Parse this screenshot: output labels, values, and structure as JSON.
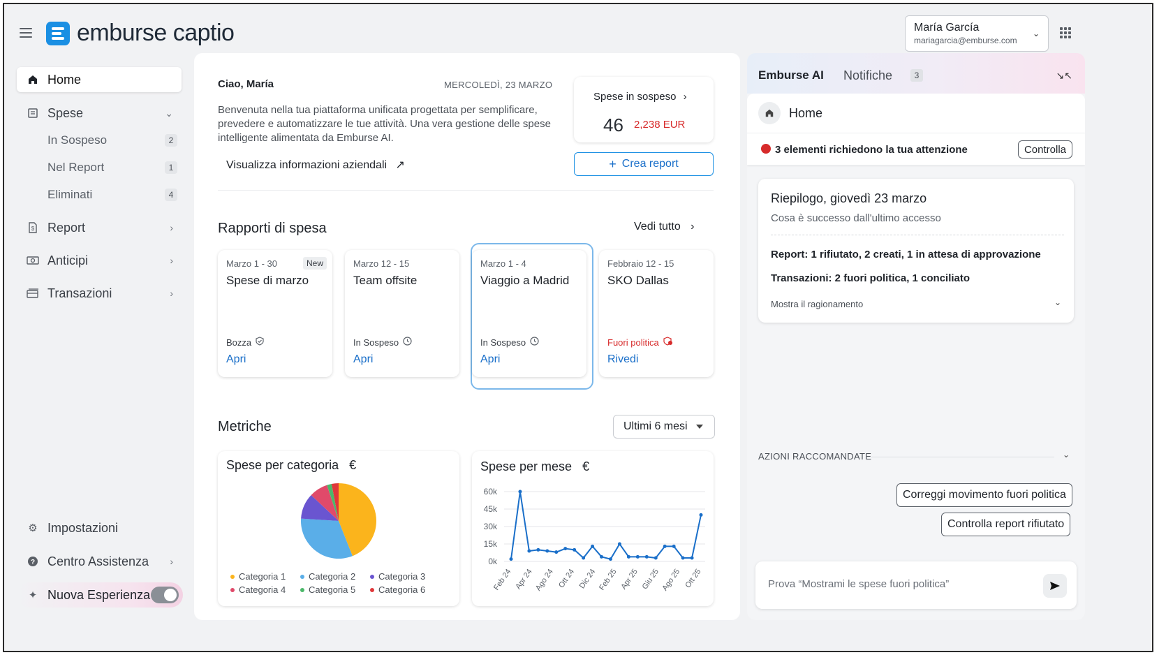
{
  "app": {
    "logo_text": "emburse captio",
    "brand_color": "#1a8fe3"
  },
  "user": {
    "name": "María García",
    "email": "mariagarcia@emburse.com"
  },
  "sidebar": {
    "home": "Home",
    "spese": "Spese",
    "sub": [
      {
        "label": "In Sospeso",
        "count": "2"
      },
      {
        "label": "Nel Report",
        "count": "1"
      },
      {
        "label": "Eliminati",
        "count": "4"
      }
    ],
    "report": "Report",
    "anticipi": "Anticipi",
    "transazioni": "Transazioni",
    "impostazioni": "Impostazioni",
    "assistenza": "Centro Assistenza",
    "nuova": "Nuova Esperienza"
  },
  "main": {
    "greeting": "Ciao, María",
    "date": "MERCOLEDÌ, 23 MARZO",
    "welcome": "Benvenuta nella tua piattaforma unificata progettata per semplificare, prevedere e automatizzare le tue attività. Una vera gestione delle spese intelligente alimentata da Emburse AI.",
    "company_link": "Visualizza informazioni aziendali",
    "pending": {
      "title": "Spese in sospeso",
      "count": "46",
      "amount": "2,238 EUR"
    },
    "create_button": "Crea report",
    "reports_title": "Rapporti di spesa",
    "see_all": "Vedi tutto",
    "reports": [
      {
        "dates": "Marzo 1 - 30",
        "badge": "New",
        "name": "Spese di marzo",
        "status": "Bozza",
        "action": "Apri"
      },
      {
        "dates": "Marzo 12 - 15",
        "name": "Team offsite",
        "status": "In Sospeso",
        "action": "Apri"
      },
      {
        "dates": "Marzo 1 - 4",
        "name": "Viaggio a Madrid",
        "status": "In Sospeso",
        "action": "Apri"
      },
      {
        "dates": "Febbraio 12 - 15",
        "name": "SKO Dallas",
        "status": "Fuori politica",
        "action": "Rivedi"
      }
    ],
    "metrics_title": "Metriche",
    "period": "Ultimi 6 mesi",
    "euro_symbol": "€"
  },
  "chart_data": [
    {
      "type": "pie",
      "title": "Spese per categoria",
      "categories": [
        "Categoria 1",
        "Categoria 2",
        "Categoria 3",
        "Categoria 4",
        "Categoria 5",
        "Categoria 6"
      ],
      "values": [
        44,
        32,
        11,
        8,
        2,
        3
      ],
      "colors": [
        "#fbb41c",
        "#5aaee8",
        "#6a55d0",
        "#e04a6a",
        "#4cb86a",
        "#e0383a"
      ]
    },
    {
      "type": "line",
      "title": "Spese per mese",
      "x": [
        "Feb 24",
        "",
        "Apr 24",
        "",
        "Ago 24",
        "",
        "Ott 24",
        "",
        "Dic 24",
        "",
        "Feb 25",
        "",
        "Apr 25",
        "",
        "Giu 25",
        "",
        "Ago 25",
        "",
        "Ott 25",
        ""
      ],
      "xlabels": [
        "Feb 24",
        "Apr 24",
        "Ago 24",
        "Ott 24",
        "Dic 24",
        "Feb 25",
        "Apr 25",
        "Giu 25",
        "Ago 25",
        "Ott 25"
      ],
      "yticks": [
        "0k",
        "15k",
        "30k",
        "45k",
        "60k"
      ],
      "ylim": [
        0,
        60000
      ],
      "values": [
        2000,
        60000,
        9000,
        10000,
        9000,
        8000,
        11000,
        10000,
        3000,
        13000,
        4000,
        2000,
        15000,
        4000,
        4000,
        4000,
        3000,
        13000,
        13000,
        3000,
        3000,
        40000
      ],
      "color": "#1a6fc9"
    }
  ],
  "ai": {
    "tab_ai": "Emburse AI",
    "tab_notifications": "Notifiche",
    "notifications_count": "3",
    "home_label": "Home",
    "attention": "3 elementi richiedono la tua attenzione",
    "check_button": "Controlla",
    "summary_title": "Riepilogo, giovedì 23 marzo",
    "summary_sub": "Cosa è successo dall'ultimo accesso",
    "summary_report": "Report: 1 rifiutato, 2 creati, 1 in attesa di approvazione",
    "summary_transactions": "Transazioni: 2 fuori politica, 1 conciliato",
    "reasoning": "Mostra il ragionamento",
    "recommended_label": "AZIONI RACCOMANDATE",
    "action_1": "Correggi movimento fuori politica",
    "action_2": "Controlla report rifiutato",
    "prompt_placeholder": "Prova “Mostrami le spese fuori politica”"
  }
}
